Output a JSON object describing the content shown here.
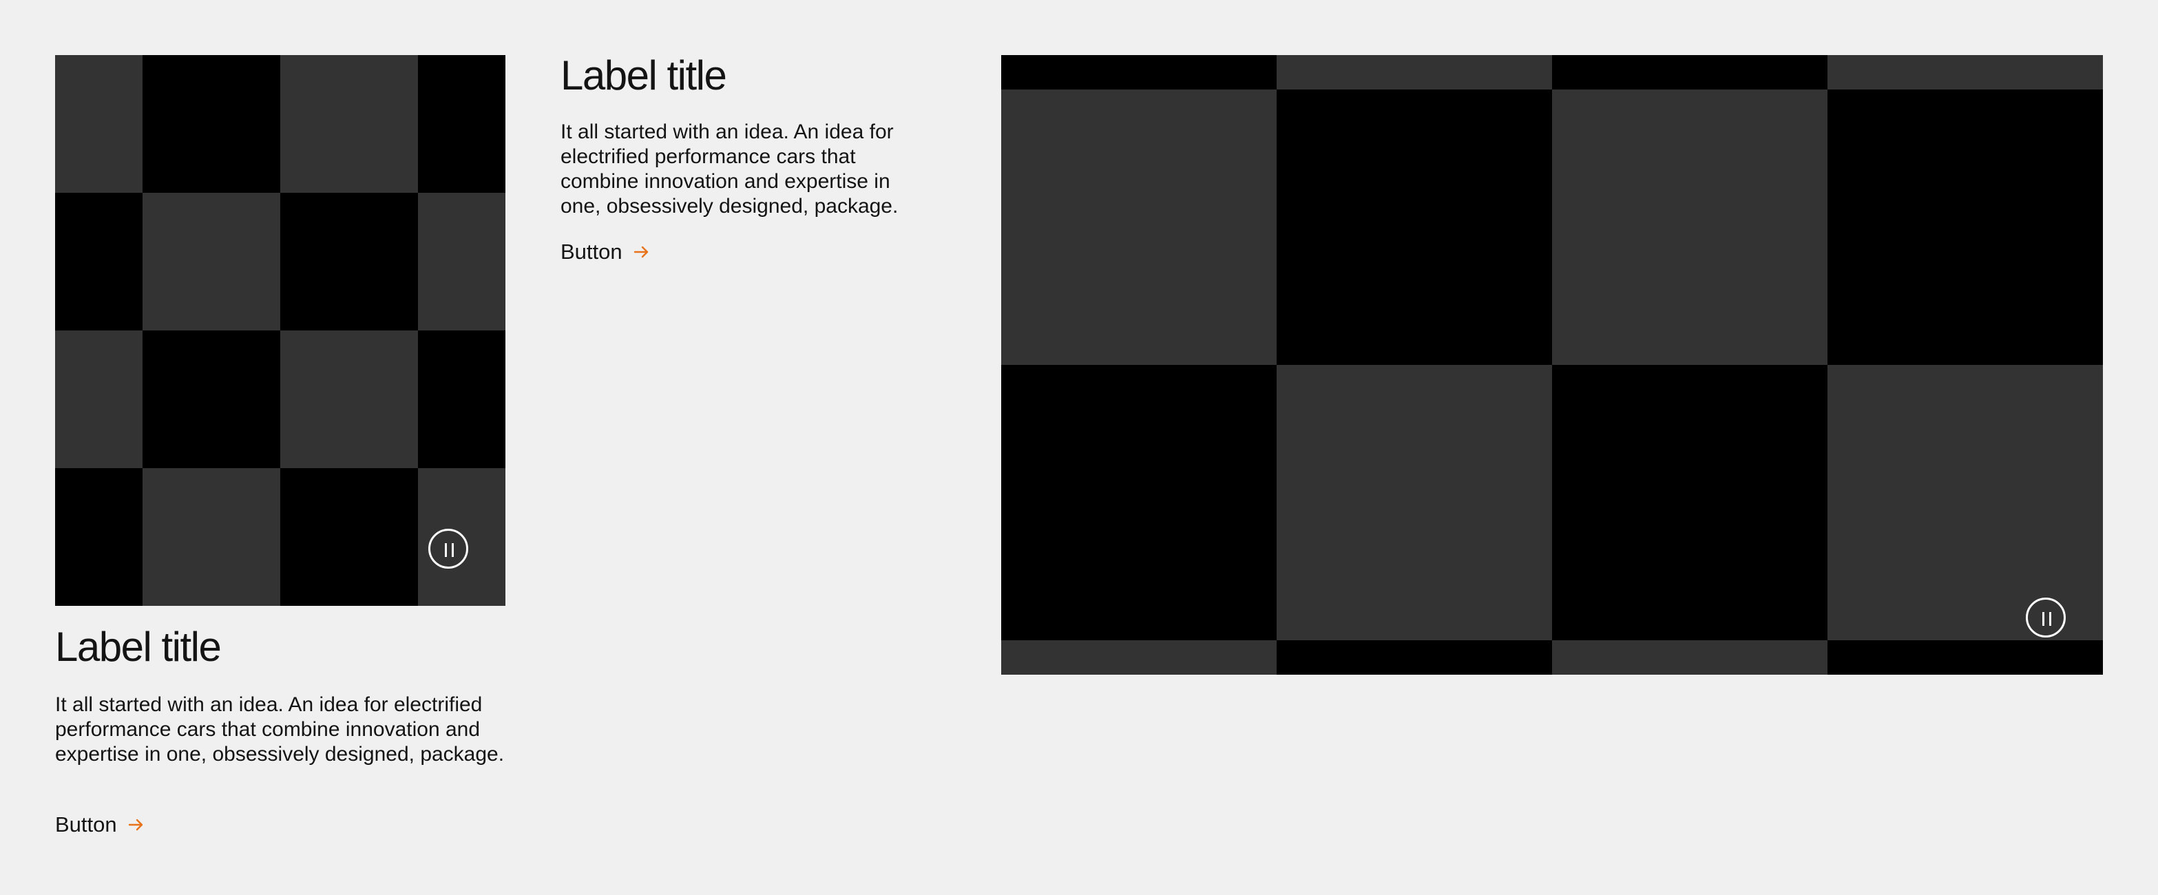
{
  "cards": [
    {
      "title": "Label title",
      "description": "It all started with an idea. An idea for electrified performance cars that combine innovation and expertise in one, obsessively designed, package.",
      "button_label": "Button",
      "button_icon": "arrow-right-icon",
      "media_control_icon": "pause-icon"
    },
    {
      "title": "Label title",
      "description": "It all started with an idea. An idea for electrified performance cars that combine innovation and expertise in one, obsessively designed, package.",
      "button_label": "Button",
      "button_icon": "arrow-right-icon"
    }
  ],
  "feature_media": {
    "media_control_icon": "pause-icon"
  },
  "colors": {
    "background": "#f0f0f0",
    "text": "#141414",
    "accent": "#e8731a",
    "media_dark": "#000000",
    "media_light": "#333333"
  }
}
